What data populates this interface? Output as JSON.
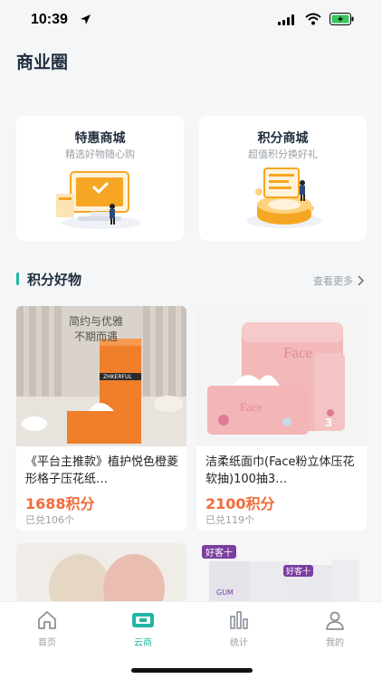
{
  "status": {
    "time": "10:39"
  },
  "page": {
    "title": "商业圈"
  },
  "malls": [
    {
      "title": "特惠商城",
      "subtitle": "精选好物随心购",
      "icon": "shop-illustration-icon"
    },
    {
      "title": "积分商城",
      "subtitle": "超值积分换好礼",
      "icon": "points-illustration-icon"
    }
  ],
  "section": {
    "title": "积分好物",
    "more": "查看更多"
  },
  "products": [
    {
      "name": "《平台主推款》植护悦色橙菱形格子压花纸…",
      "points": "1688积分",
      "sold": "已兑106个",
      "image_text": [
        "简约与优雅",
        "不期而遇"
      ],
      "brand_text": "ZHKERFUL"
    },
    {
      "name": "洁柔纸面巾(Face粉立体压花软抽)100抽3…",
      "points": "2100积分",
      "sold": "已兑119个",
      "image_text": [
        "Face",
        "Face",
        "3"
      ]
    },
    {
      "name": "",
      "points": "",
      "sold": ""
    },
    {
      "name": "",
      "points": "",
      "sold": "",
      "image_text": [
        "好客十",
        "好客十",
        "GUM"
      ]
    }
  ],
  "tabs": [
    {
      "label": "首页",
      "icon": "home-icon",
      "active": false
    },
    {
      "label": "云商",
      "icon": "cloud-shop-icon",
      "active": true
    },
    {
      "label": "统计",
      "icon": "statistics-icon",
      "active": false
    },
    {
      "label": "我的",
      "icon": "profile-icon",
      "active": false
    }
  ],
  "colors": {
    "accent": "#23b5a3",
    "points": "#f26b3a",
    "illustration": "#f5a623"
  }
}
